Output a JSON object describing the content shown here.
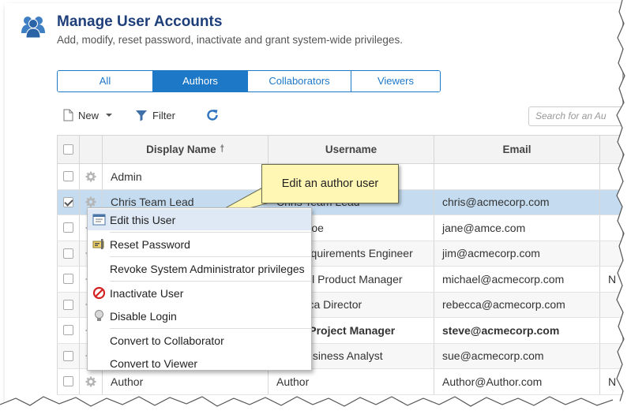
{
  "header": {
    "title": "Manage User Accounts",
    "subtitle": "Add, modify, reset password, inactivate and grant system-wide privileges.",
    "icon": "users-icon"
  },
  "tabs": [
    {
      "label": "All",
      "active": false
    },
    {
      "label": "Authors",
      "active": true
    },
    {
      "label": "Collaborators",
      "active": false
    },
    {
      "label": "Viewers",
      "active": false
    }
  ],
  "toolbar": {
    "new_label": "New",
    "filter_label": "Filter",
    "search_placeholder": "Search for an Au"
  },
  "table": {
    "columns": {
      "display_name": "Display Name",
      "username": "Username",
      "email": "Email"
    },
    "rows": [
      {
        "checked": false,
        "display_name": "Admin",
        "username": "",
        "email": "",
        "more": ""
      },
      {
        "checked": true,
        "display_name": "Chris Team Lead",
        "username": "Chris Team Lead",
        "email": "chris@acmecorp.com",
        "more": ""
      },
      {
        "checked": false,
        "display_name": "",
        "username": "Jane Doe",
        "email": "jane@amce.com",
        "more": ""
      },
      {
        "checked": false,
        "display_name": "",
        "username": "Jim Requirements Engineer",
        "email": "jim@acmecorp.com",
        "more": ""
      },
      {
        "checked": false,
        "display_name": "",
        "username": "Michael Product Manager",
        "email": "michael@acmecorp.com",
        "more": "N"
      },
      {
        "checked": false,
        "display_name": "",
        "username": "Rebecca Director",
        "email": "rebecca@acmecorp.com",
        "more": ""
      },
      {
        "checked": false,
        "display_name": "",
        "username": "Steve Project Manager",
        "email": "steve@acmecorp.com",
        "more": ""
      },
      {
        "checked": false,
        "display_name": "",
        "username": "Sue Business Analyst",
        "email": "sue@acmecorp.com",
        "more": ""
      },
      {
        "checked": false,
        "display_name": "Author",
        "username": "Author",
        "email": "Author@Author.com",
        "more": "N"
      }
    ]
  },
  "context_menu": {
    "items": [
      {
        "label": "Edit this User",
        "icon": "edit-user-icon"
      },
      {
        "label": "Reset Password",
        "icon": "reset-password-icon"
      },
      {
        "label": "Revoke System Administrator privileges",
        "icon": ""
      },
      {
        "label": "Inactivate User",
        "icon": "inactivate-icon"
      },
      {
        "label": "Disable Login",
        "icon": "lightbulb-icon"
      },
      {
        "label": "Convert to Collaborator",
        "icon": ""
      },
      {
        "label": "Convert to Viewer",
        "icon": ""
      }
    ]
  },
  "callout": {
    "text": "Edit an author user"
  },
  "colors": {
    "accent": "#1e78c8",
    "title": "#1e3f7a",
    "selected_row": "#c5dcf0",
    "callout_bg": "#fff7b3"
  }
}
